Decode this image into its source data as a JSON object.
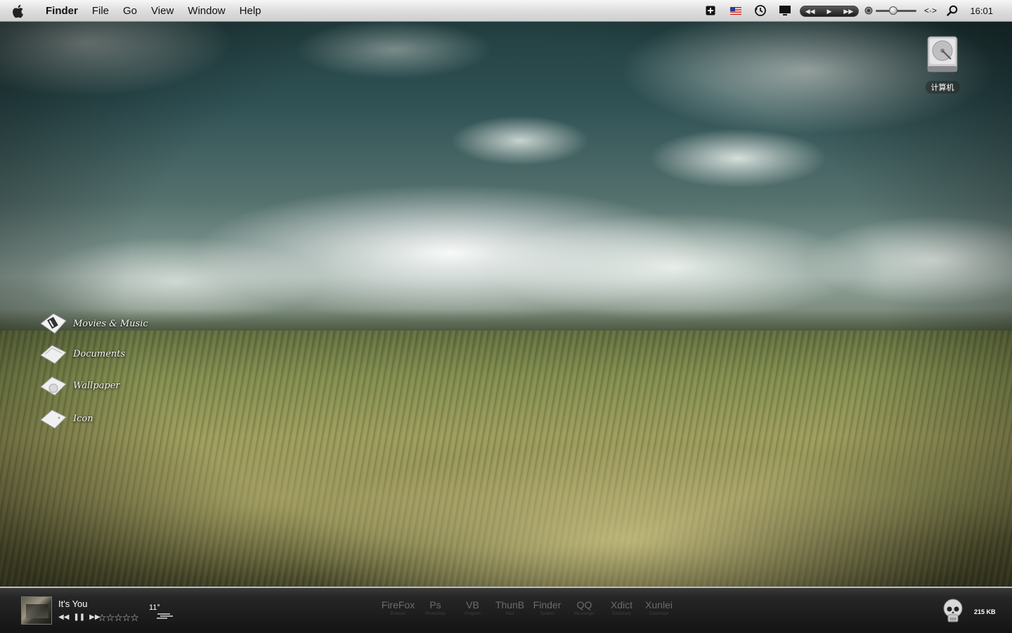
{
  "menubar": {
    "app_name": "Finder",
    "items": [
      "File",
      "Go",
      "View",
      "Window",
      "Help"
    ],
    "clock": "16:01",
    "status_icons": [
      "add-icon",
      "us-flag-icon",
      "time-machine-icon",
      "display-icon",
      "media-controls",
      "volume-slider",
      "code-icon",
      "spotlight-icon"
    ]
  },
  "desktop": {
    "drive": {
      "label": "计算机"
    },
    "folders": [
      {
        "label": "Movies & Music"
      },
      {
        "label": "Documents"
      },
      {
        "label": "Wallpaper"
      },
      {
        "label": "Icon"
      }
    ]
  },
  "bottombar": {
    "now_playing": {
      "title": "It's You",
      "rating": "☆☆☆☆☆"
    },
    "weather": {
      "temperature": "11°"
    },
    "dock": [
      {
        "name": "FireFox",
        "sub": "Browser"
      },
      {
        "name": "Ps",
        "sub": "Photoshop"
      },
      {
        "name": "VB",
        "sub": "Program"
      },
      {
        "name": "ThunB",
        "sub": "Mail"
      },
      {
        "name": "Finder",
        "sub": "System"
      },
      {
        "name": "QQ",
        "sub": "Messenger"
      },
      {
        "name": "Xdict",
        "sub": "Dictionary"
      },
      {
        "name": "Xunlei",
        "sub": "Download"
      }
    ],
    "net_speed": "215 KB"
  },
  "colors": {
    "menubar": "#dcdcdc",
    "bottombar": "#1a1a1a",
    "dock_text": "#6c6c6c"
  }
}
